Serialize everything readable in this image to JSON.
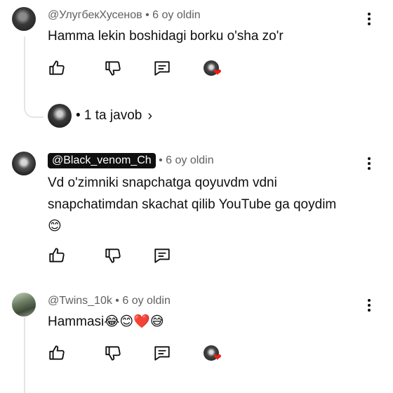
{
  "comments": [
    {
      "handle": "@УлугбекХусенов",
      "age": "• 6 oy oldin",
      "text": "Hamma lekin boshidagi borku o'sha zo'r",
      "replies_label": "• 1 ta javob",
      "has_heart": true
    },
    {
      "handle": "@Black_venom_Ch",
      "age": "• 6 oy oldin",
      "text_line1": "Vd o'zimniki snapchatga qoyuvdm vdni",
      "text_line2": "snapchatimdan skachat qilib YouTube ga qoydim",
      "text_emoji": "😊",
      "has_heart": false
    },
    {
      "handle": "@Twins_10k",
      "age": "• 6 oy oldin",
      "text": "Hammasi",
      "text_emoji": "😂😊❤️😅",
      "has_heart": true
    }
  ],
  "icons": {
    "like": "thumb-up-icon",
    "dislike": "thumb-down-icon",
    "reply": "reply-comment-icon",
    "more": "more-vert-icon",
    "heart": "creator-heart-icon",
    "chevron": "chevron-right-icon"
  },
  "colors": {
    "heart": "#e62117",
    "text": "#0f0f0f",
    "meta": "#606060",
    "pill": "#0f0f0f"
  },
  "glyphs": {
    "heart": "❤",
    "chevron": "›"
  }
}
